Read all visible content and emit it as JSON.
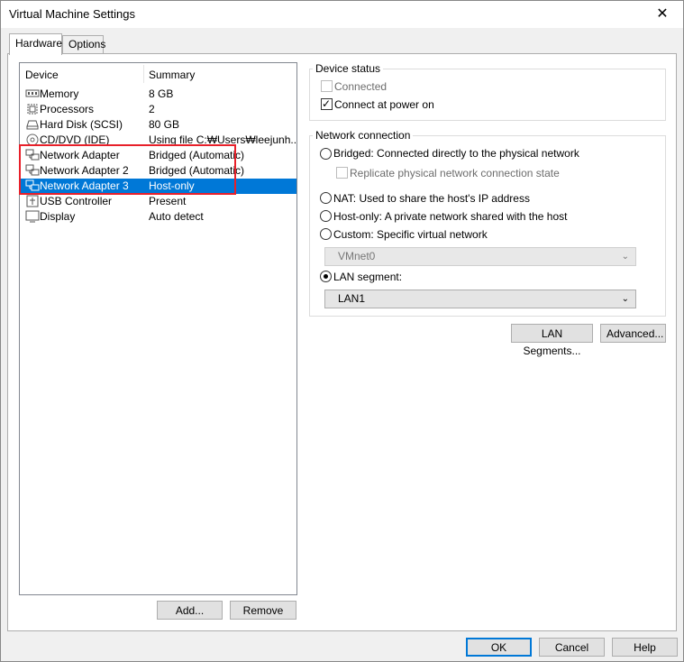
{
  "window": {
    "title": "Virtual Machine Settings",
    "close_glyph": "✕"
  },
  "tabs": [
    {
      "label": "Hardware",
      "active": true
    },
    {
      "label": "Options",
      "active": false
    }
  ],
  "device_list": {
    "headers": {
      "device": "Device",
      "summary": "Summary"
    },
    "rows": [
      {
        "icon": "memory-icon",
        "name": "Memory",
        "summary": "8 GB"
      },
      {
        "icon": "processor-icon",
        "name": "Processors",
        "summary": "2"
      },
      {
        "icon": "hard-disk-icon",
        "name": "Hard Disk (SCSI)",
        "summary": "80 GB"
      },
      {
        "icon": "cd-dvd-icon",
        "name": "CD/DVD (IDE)",
        "summary": "Using file C:₩Users₩leejunh..."
      },
      {
        "icon": "network-adapter-icon",
        "name": "Network Adapter",
        "summary": "Bridged (Automatic)"
      },
      {
        "icon": "network-adapter-icon",
        "name": "Network Adapter 2",
        "summary": "Bridged (Automatic)"
      },
      {
        "icon": "network-adapter-icon",
        "name": "Network Adapter 3",
        "summary": "Host-only",
        "selected": true
      },
      {
        "icon": "usb-controller-icon",
        "name": "USB Controller",
        "summary": "Present"
      },
      {
        "icon": "display-icon",
        "name": "Display",
        "summary": "Auto detect"
      }
    ],
    "add_label": "Add...",
    "remove_label": "Remove"
  },
  "device_status": {
    "title": "Device status",
    "connected": {
      "label": "Connected",
      "checked": false,
      "disabled": true
    },
    "connect_power_on": {
      "label": "Connect at power on",
      "checked": true
    }
  },
  "network_connection": {
    "title": "Network connection",
    "bridged": {
      "label": "Bridged: Connected directly to the physical network",
      "selected": false
    },
    "replicate": {
      "label": "Replicate physical network connection state",
      "checked": false,
      "disabled": true
    },
    "nat": {
      "label": "NAT: Used to share the host's IP address",
      "selected": false
    },
    "host_only": {
      "label": "Host-only: A private network shared with the host",
      "selected": false
    },
    "custom": {
      "label": "Custom: Specific virtual network",
      "selected": false
    },
    "vmnet_select": {
      "value": "VMnet0",
      "disabled": true
    },
    "lan_segment": {
      "label": "LAN segment:",
      "selected": true
    },
    "lan_select": {
      "value": "LAN1"
    }
  },
  "buttons": {
    "lan_segments": "LAN Segments...",
    "advanced": "Advanced...",
    "ok": "OK",
    "cancel": "Cancel",
    "help": "Help"
  },
  "colors": {
    "selection": "#0078d7",
    "highlight_box": "#e8202a"
  }
}
